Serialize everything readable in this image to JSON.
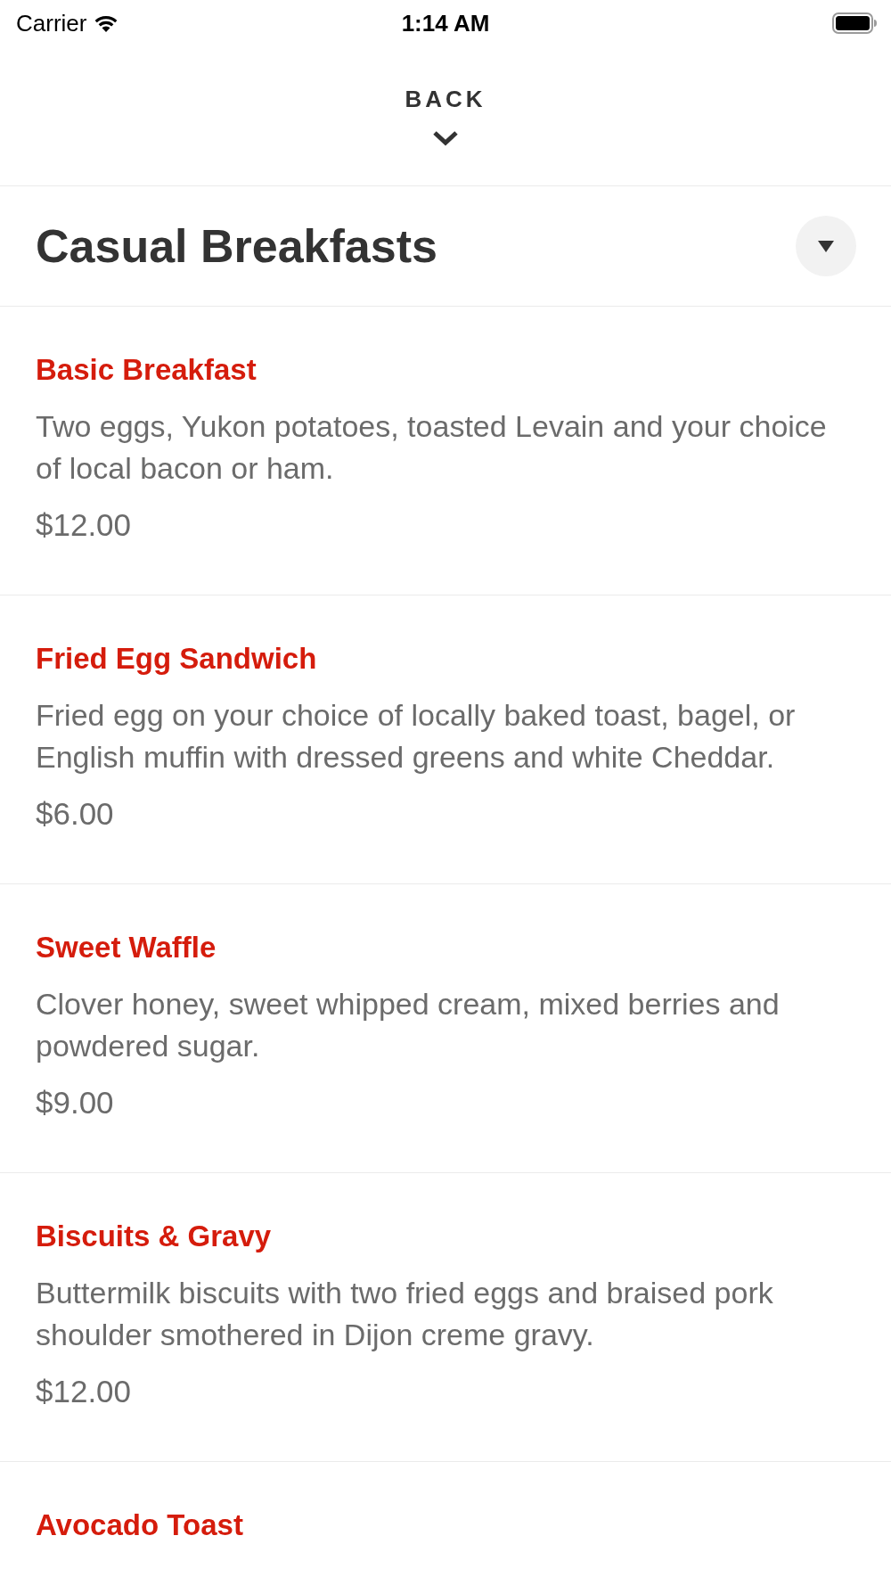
{
  "status_bar": {
    "carrier": "Carrier",
    "time": "1:14 AM"
  },
  "back_button": {
    "label": "BACK"
  },
  "category": {
    "title": "Casual Breakfasts"
  },
  "menu_items": [
    {
      "name": "Basic Breakfast",
      "description": "Two eggs, Yukon potatoes, toasted Levain and your choice of local bacon or ham.",
      "price": "$12.00"
    },
    {
      "name": "Fried Egg Sandwich",
      "description": "Fried egg on your choice of locally baked toast, bagel, or English muffin with dressed greens and white Cheddar.",
      "price": "$6.00"
    },
    {
      "name": "Sweet Waffle",
      "description": "Clover honey, sweet whipped cream, mixed berries and powdered sugar.",
      "price": "$9.00"
    },
    {
      "name": "Biscuits & Gravy",
      "description": "Buttermilk biscuits with two fried eggs and braised pork shoulder smothered in Dijon creme gravy.",
      "price": "$12.00"
    },
    {
      "name": "Avocado Toast"
    }
  ]
}
